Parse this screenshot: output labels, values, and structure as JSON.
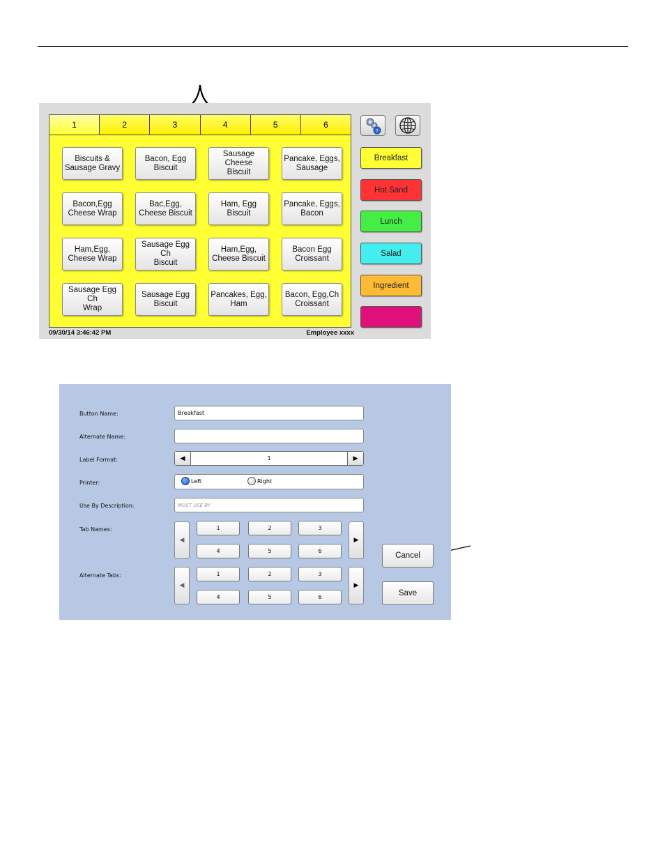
{
  "screen1": {
    "tabs": [
      "1",
      "2",
      "3",
      "4",
      "5",
      "6"
    ],
    "active_tab": "1",
    "items": [
      "Biscuits &\nSausage Gravy",
      "Bacon, Egg\nBiscuit",
      "Sausage Cheese\nBiscuit",
      "Pancake,  Eggs,\nSausage",
      "Bacon,Egg\nCheese Wrap",
      "Bac,Egg,\nCheese Biscuit",
      "Ham, Egg\nBiscuit",
      "Pancake,  Eggs,\nBacon",
      "Ham,Egg,\nCheese Wrap",
      "Sausage Egg Ch\nBiscuit",
      "Ham,Egg,\nCheese Biscuit",
      "Bacon Egg\nCroissant",
      "Sausage Egg Ch\nWrap",
      "Sausage  Egg\nBiscuit",
      "Pancakes,  Egg,\nHam",
      "Bacon, Egg,Ch\nCroissant"
    ],
    "status": {
      "datetime": "09/30/14  3:46:42 PM",
      "employee": "Employee xxxx"
    },
    "icons": {
      "settings": "gear-help-icon",
      "globe": "globe-icon"
    },
    "categories": [
      {
        "label": "Breakfast",
        "color": "#ffff33"
      },
      {
        "label": "Hot Sand",
        "color": "#ff3333"
      },
      {
        "label": "Lunch",
        "color": "#44ee44"
      },
      {
        "label": "Salad",
        "color": "#44eeee"
      },
      {
        "label": "Ingredient",
        "color": "#ffbb33"
      },
      {
        "label": "",
        "color": "#e0107a"
      }
    ]
  },
  "screen2": {
    "labels": {
      "button_name": "Button Name:",
      "alternate_name": "Alternate Name:",
      "label_format": "Label Format:",
      "printer": "Printer:",
      "use_by": "Use By Description:",
      "tab_names": "Tab Names:",
      "alternate_tabs": "Alternate Tabs:"
    },
    "button_name_value": "Breakfast",
    "alternate_name_value": "",
    "label_format_value": "1",
    "printer_options": [
      "Left",
      "Right"
    ],
    "printer_selected": "Left",
    "use_by_placeholder": "MUST USE BY",
    "tab_names": [
      "1",
      "2",
      "3",
      "4",
      "5",
      "6"
    ],
    "alternate_tabs": [
      "1",
      "2",
      "3",
      "4",
      "5",
      "6"
    ],
    "buttons": {
      "cancel": "Cancel",
      "save": "Save"
    }
  },
  "colors": {
    "menu_bg": "#ffff33",
    "screen1_bg": "#dcdcdc",
    "screen2_bg": "#b6c8e4"
  }
}
